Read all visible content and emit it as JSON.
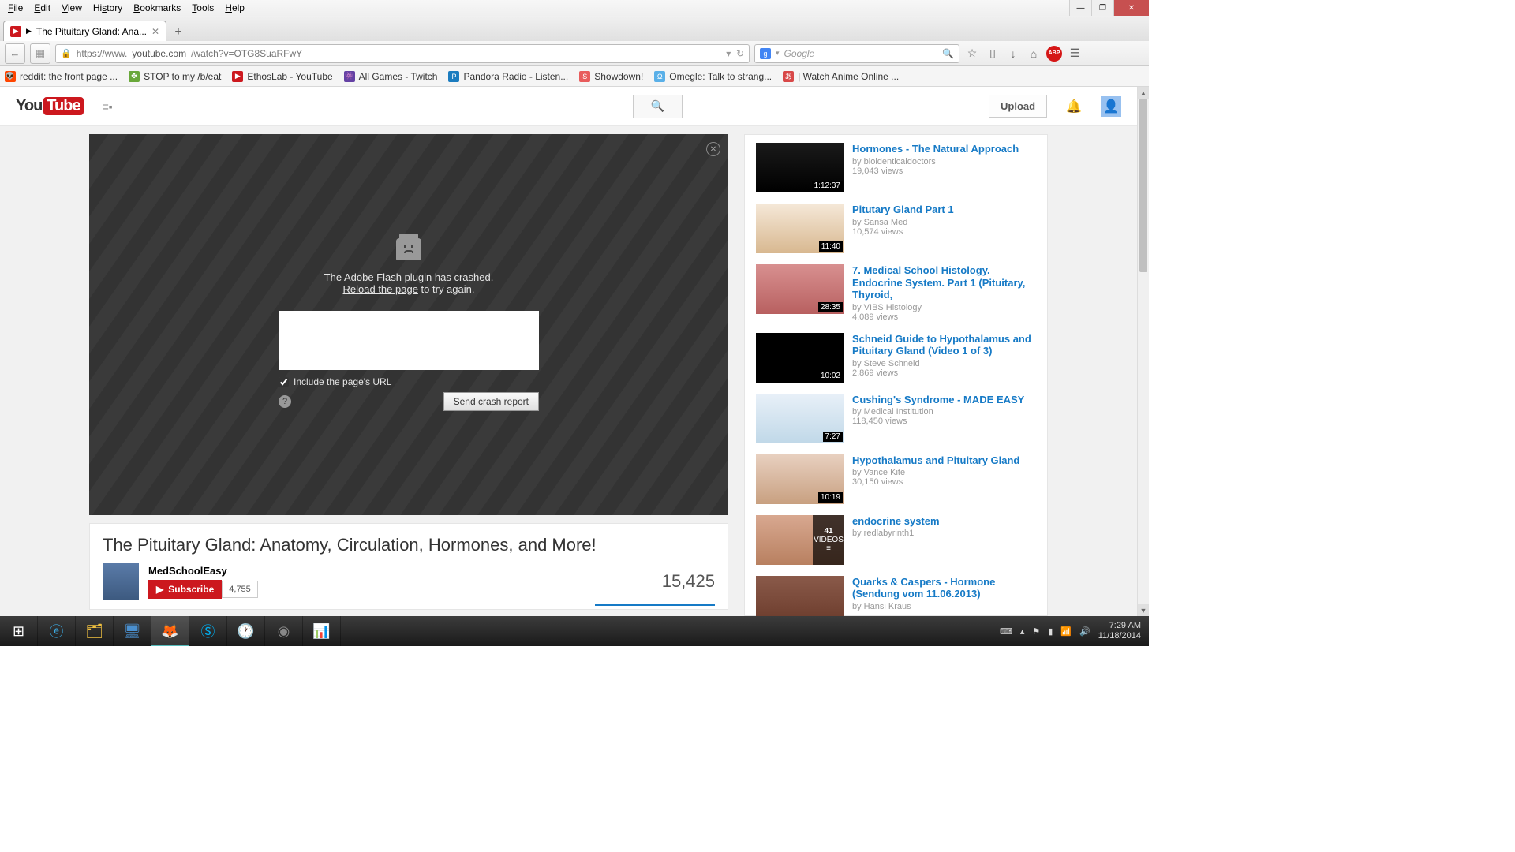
{
  "menubar": [
    "File",
    "Edit",
    "View",
    "History",
    "Bookmarks",
    "Tools",
    "Help"
  ],
  "tab": {
    "title": "The Pituitary Gland: Ana..."
  },
  "url": {
    "scheme": "https://www.",
    "host": "youtube.com",
    "path": "/watch?v=OTG8SuaRFwY"
  },
  "search": {
    "engine": "Google",
    "placeholder": "Google"
  },
  "bookmarks": [
    {
      "icon": "👽",
      "label": "reddit: the front page ..."
    },
    {
      "icon": "🍀",
      "label": "STOP to my /b/eat"
    },
    {
      "icon": "▶",
      "label": "EthosLab - YouTube",
      "red": true
    },
    {
      "icon": "👾",
      "label": "All Games - Twitch"
    },
    {
      "icon": "P",
      "label": "Pandora Radio - Listen..."
    },
    {
      "icon": "S",
      "label": "Showdown!"
    },
    {
      "icon": "Ω",
      "label": "Omegle: Talk to strang..."
    },
    {
      "icon": "🗾",
      "label": "| Watch Anime Online ..."
    }
  ],
  "yt": {
    "upload": "Upload",
    "crash": {
      "line1": "The Adobe Flash plugin has crashed.",
      "reload": "Reload the page",
      "line2": " to try again.",
      "checkbox": "Include the page's URL",
      "button": "Send crash report"
    },
    "title": "The Pituitary Gland: Anatomy, Circulation, Hormones, and More!",
    "channel": "MedSchoolEasy",
    "subscribe": "Subscribe",
    "subs": "4,755",
    "views": "15,425"
  },
  "related": [
    {
      "title": "Hormones - The Natural Approach",
      "by": "bioidenticaldoctors",
      "views": "19,043 views",
      "dur": "1:12:37"
    },
    {
      "title": "Pitutary Gland Part 1",
      "by": "Sansa Med",
      "views": "10,574 views",
      "dur": "11:40"
    },
    {
      "title": "7. Medical School Histology. Endocrine System. Part 1 (Pituitary, Thyroid,",
      "by": "VIBS Histology",
      "views": "4,089 views",
      "dur": "28:35"
    },
    {
      "title": "Schneid Guide to Hypothalamus and Pituitary Gland (Video 1 of 3)",
      "by": "Steve Schneid",
      "views": "2,869 views",
      "dur": "10:02"
    },
    {
      "title": "Cushing's Syndrome - MADE EASY",
      "by": "Medical Institution",
      "views": "118,450 views",
      "dur": "7:27"
    },
    {
      "title": "Hypothalamus and Pituitary Gland",
      "by": "Vance Kite",
      "views": "30,150 views",
      "dur": "10:19"
    },
    {
      "title": "endocrine system",
      "by": "redlabyrinth1",
      "views": "",
      "playlist": "41",
      "pllabel": "VIDEOS"
    },
    {
      "title": "Quarks & Caspers - Hormone (Sendung vom 11.06.2013)",
      "by": "Hansi Kraus",
      "views": ""
    }
  ],
  "tray": {
    "time": "7:29 AM",
    "date": "11/18/2014"
  }
}
